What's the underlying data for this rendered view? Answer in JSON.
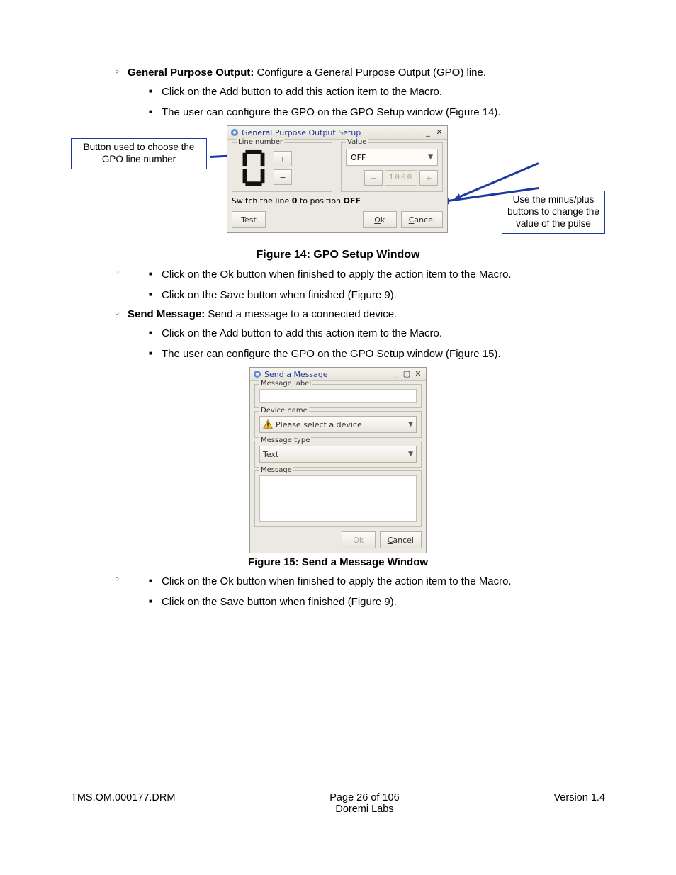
{
  "section1": {
    "heading_bold": "General Purpose Output:",
    "heading_rest": " Configure a General Purpose Output (GPO) line.",
    "b1": "Click on the Add button to add this action item to the Macro.",
    "b2": "The user can configure the GPO on the GPO Setup window (Figure 14)."
  },
  "callouts": {
    "left": "Button used to choose the GPO line number",
    "right": "Use the minus/plus buttons to change the value of the pulse"
  },
  "gpo": {
    "title": "General Purpose Output Setup",
    "line_legend": "Line number",
    "value_legend": "Value",
    "digit": "0",
    "plus": "+",
    "minus": "−",
    "value_option": "OFF",
    "pulse_value": "1000",
    "switch_text_pre": "Switch the line ",
    "switch_text_mid": "0",
    "switch_text_post": " to position ",
    "switch_text_end": "OFF",
    "test": "Test",
    "ok": "Ok",
    "cancel": "Cancel"
  },
  "fig14": "Figure 14: GPO Setup Window",
  "after14": {
    "b1": "Click on the Ok button when finished to apply the action item to the Macro.",
    "b2": "Click on the Save button when finished (Figure 9)."
  },
  "section2": {
    "heading_bold": "Send Message:",
    "heading_rest": " Send a message to a connected device.",
    "b1": "Click on the Add button to add this action item to the Macro.",
    "b2": "The user can configure the GPO on the GPO Setup window (Figure 15)."
  },
  "msg": {
    "title": "Send a Message",
    "label_legend": "Message label",
    "device_legend": "Device name",
    "device_placeholder": "Please select a device",
    "type_legend": "Message type",
    "type_value": "Text",
    "msg_legend": "Message",
    "ok": "Ok",
    "cancel": "Cancel"
  },
  "fig15": "Figure 15: Send a Message Window",
  "after15": {
    "b1": "Click on the Ok button when finished to apply the action item to the Macro.",
    "b2": "Click on the Save button when finished (Figure 9)."
  },
  "footer": {
    "left": "TMS.OM.000177.DRM",
    "center1": "Page 26 of 106",
    "center2": "Doremi Labs",
    "right": "Version 1.4"
  }
}
